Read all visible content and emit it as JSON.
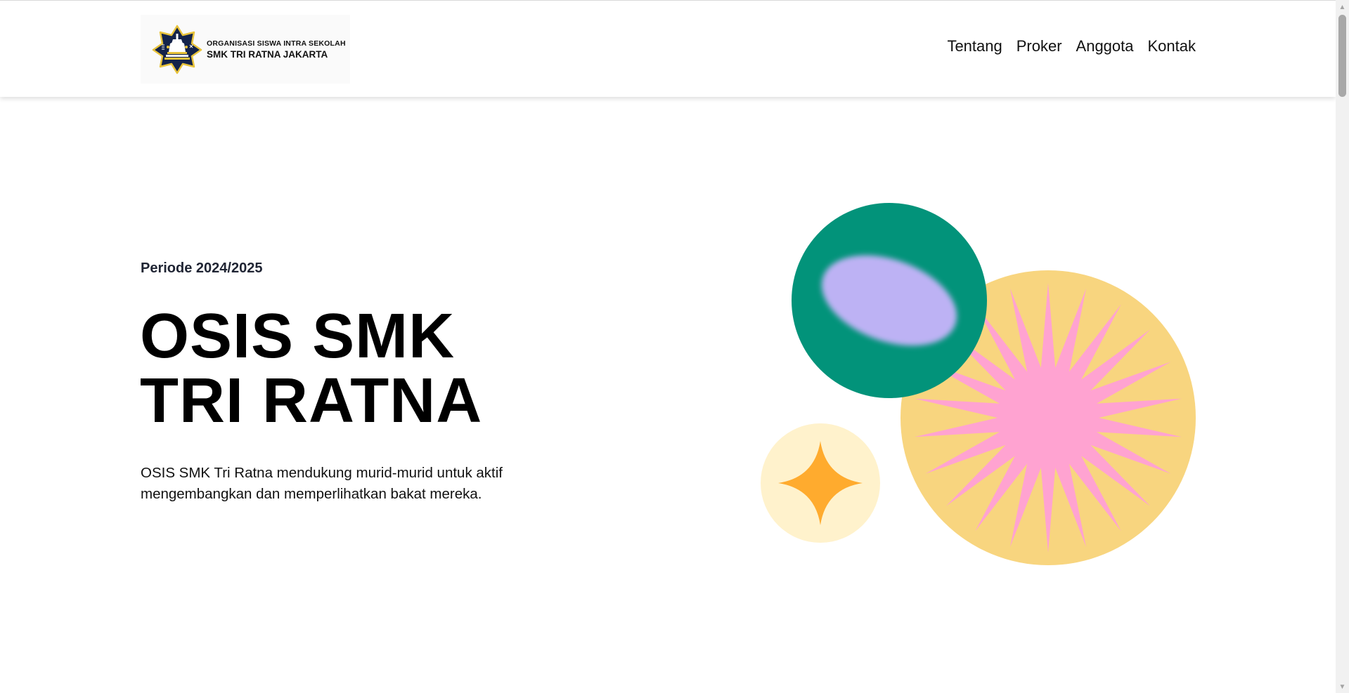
{
  "header": {
    "logo_line1": "ORGANISASI SISWA INTRA SEKOLAH",
    "logo_line2": "SMK TRI RATNA JAKARTA",
    "logo_icon": "school-emblem-icon"
  },
  "nav": {
    "items": [
      {
        "label": "Tentang"
      },
      {
        "label": "Proker"
      },
      {
        "label": "Anggota"
      },
      {
        "label": "Kontak"
      }
    ]
  },
  "hero": {
    "period": "Periode 2024/2025",
    "title_line1": "OSIS SMK",
    "title_line2": "TRI RATNA",
    "description": "OSIS SMK Tri Ratna mendukung murid-murid untuk aktif mengembangkan dan memperlihatkan bakat mereka."
  },
  "colors": {
    "green_circle": "#02937A",
    "lavender_blob": "#BDB2F4",
    "yellow_circle": "#F8D57F",
    "pink_star": "#FFA3D1",
    "cream_circle": "#FFF2CC",
    "orange_star": "#FFAB2E",
    "emblem_navy": "#14234A",
    "emblem_gold": "#E8C33B"
  }
}
